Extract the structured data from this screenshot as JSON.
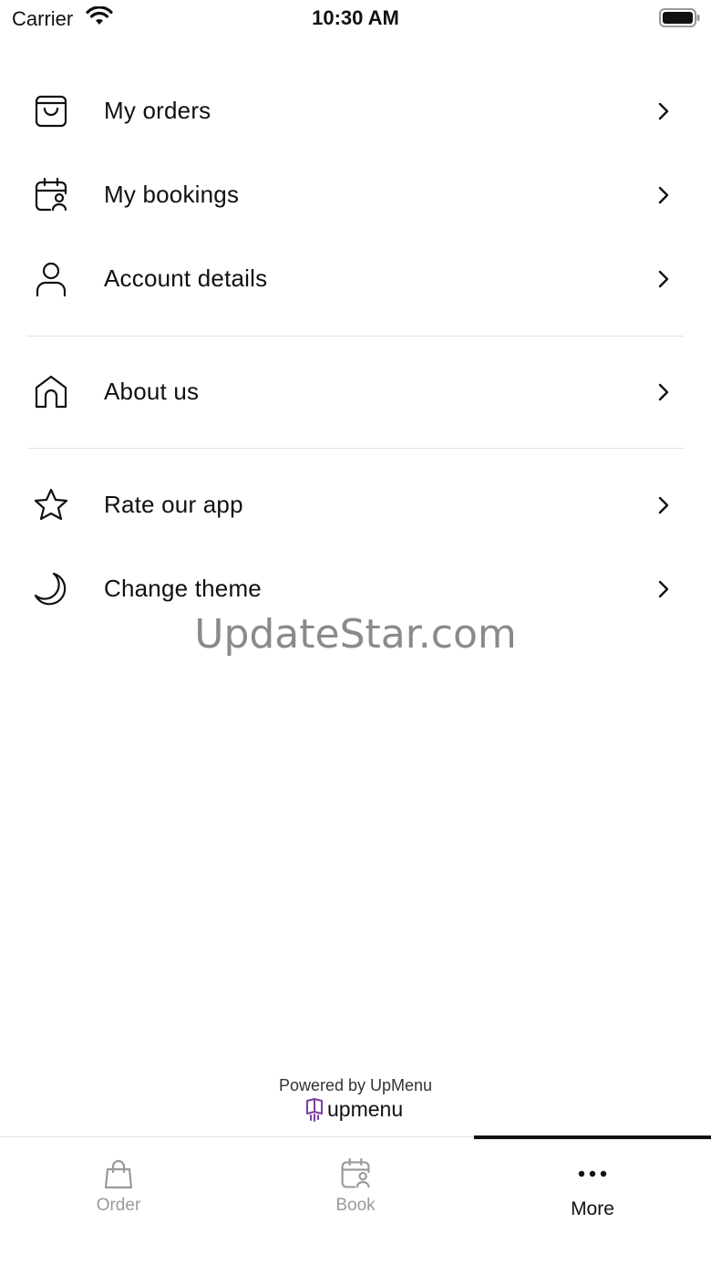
{
  "status_bar": {
    "carrier": "Carrier",
    "time": "10:30 AM"
  },
  "menu": {
    "items": [
      {
        "label": "My orders",
        "icon": "shopping-bag-icon"
      },
      {
        "label": "My bookings",
        "icon": "calendar-user-icon"
      },
      {
        "label": "Account details",
        "icon": "user-icon"
      },
      {
        "label": "About us",
        "icon": "home-icon"
      },
      {
        "label": "Rate our app",
        "icon": "star-icon"
      },
      {
        "label": "Change theme",
        "icon": "moon-icon"
      }
    ]
  },
  "watermark": "UpdateStar.com",
  "footer": {
    "powered_by": "Powered by UpMenu",
    "brand_name": "upmenu",
    "brand_color": "#7b3fa0"
  },
  "tabbar": {
    "tabs": [
      {
        "label": "Order",
        "icon": "shopping-bag-icon",
        "active": false
      },
      {
        "label": "Book",
        "icon": "calendar-user-icon",
        "active": false
      },
      {
        "label": "More",
        "icon": "more-dots-icon",
        "active": true
      }
    ]
  }
}
